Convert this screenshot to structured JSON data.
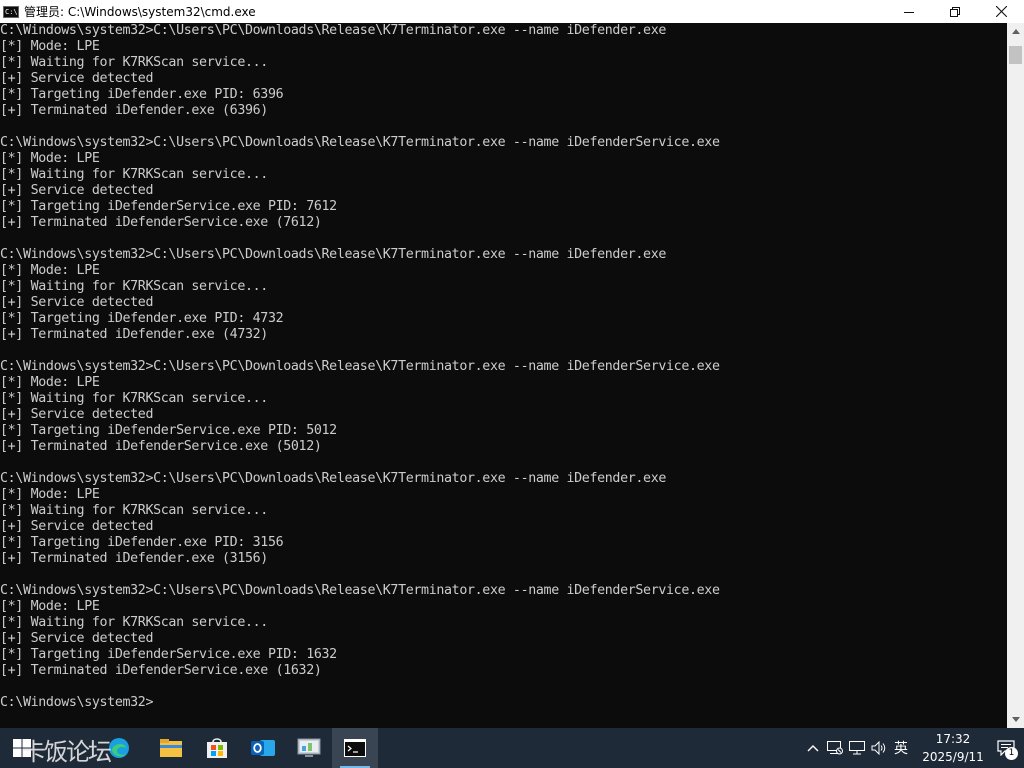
{
  "window": {
    "title": "管理员: C:\\Windows\\system32\\cmd.exe",
    "icon": "cmd-icon",
    "controls": {
      "minimize": "minimize-icon",
      "maximize": "maximize-icon",
      "close": "close-icon"
    }
  },
  "console": {
    "text": "C:\\Windows\\system32>C:\\Users\\PC\\Downloads\\Release\\K7Terminator.exe --name iDefender.exe\n[*] Mode: LPE\n[*] Waiting for K7RKScan service...\n[+] Service detected\n[*] Targeting iDefender.exe PID: 6396\n[+] Terminated iDefender.exe (6396)\n\nC:\\Windows\\system32>C:\\Users\\PC\\Downloads\\Release\\K7Terminator.exe --name iDefenderService.exe\n[*] Mode: LPE\n[*] Waiting for K7RKScan service...\n[+] Service detected\n[*] Targeting iDefenderService.exe PID: 7612\n[+] Terminated iDefenderService.exe (7612)\n\nC:\\Windows\\system32>C:\\Users\\PC\\Downloads\\Release\\K7Terminator.exe --name iDefender.exe\n[*] Mode: LPE\n[*] Waiting for K7RKScan service...\n[+] Service detected\n[*] Targeting iDefender.exe PID: 4732\n[+] Terminated iDefender.exe (4732)\n\nC:\\Windows\\system32>C:\\Users\\PC\\Downloads\\Release\\K7Terminator.exe --name iDefenderService.exe\n[*] Mode: LPE\n[*] Waiting for K7RKScan service...\n[+] Service detected\n[*] Targeting iDefenderService.exe PID: 5012\n[+] Terminated iDefenderService.exe (5012)\n\nC:\\Windows\\system32>C:\\Users\\PC\\Downloads\\Release\\K7Terminator.exe --name iDefender.exe\n[*] Mode: LPE\n[*] Waiting for K7RKScan service...\n[+] Service detected\n[*] Targeting iDefender.exe PID: 3156\n[+] Terminated iDefender.exe (3156)\n\nC:\\Windows\\system32>C:\\Users\\PC\\Downloads\\Release\\K7Terminator.exe --name iDefenderService.exe\n[*] Mode: LPE\n[*] Waiting for K7RKScan service...\n[+] Service detected\n[*] Targeting iDefenderService.exe PID: 1632\n[+] Terminated iDefenderService.exe (1632)\n\nC:\\Windows\\system32>",
    "background": "#0c0c0c",
    "foreground": "#cccccc"
  },
  "taskbar": {
    "watermark": "卡饭论坛",
    "apps": [
      {
        "name": "edge-icon"
      },
      {
        "name": "file-explorer-icon"
      },
      {
        "name": "microsoft-store-icon"
      },
      {
        "name": "outlook-icon"
      },
      {
        "name": "control-panel-icon"
      },
      {
        "name": "cmd-icon",
        "active": true
      }
    ],
    "tray": {
      "icons": [
        "chevron-up-icon",
        "network-monitor-icon",
        "network-icon",
        "volume-icon"
      ],
      "language": "英",
      "time": "17:32",
      "date": "2025/9/11",
      "notification_count": "1"
    },
    "colors": {
      "background": "#1f2a38",
      "active_indicator": "#76b9ed"
    }
  }
}
